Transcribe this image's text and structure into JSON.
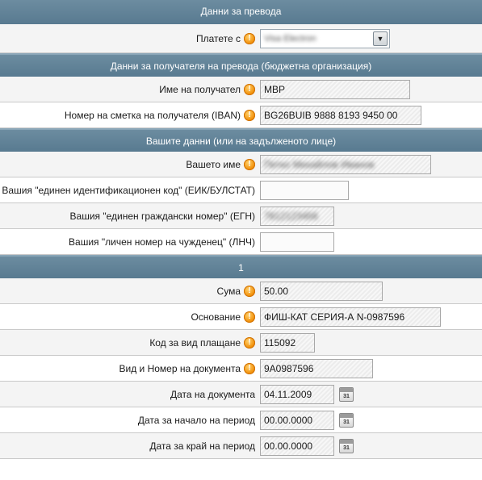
{
  "sections": {
    "transfer": "Данни за превода",
    "recipient": "Данни за получателя на превода (бюджетна организация)",
    "payer": "Вашите данни (или на задълженото лице)",
    "document": "1"
  },
  "fields": {
    "pay_with": {
      "label": "Платете с",
      "value": "Visa Electron"
    },
    "recipient_name": {
      "label": "Име на получател",
      "value": "МВР"
    },
    "recipient_iban": {
      "label": "Номер на сметка на получателя (IBAN)",
      "value": "BG26BUIB 9888 8193 9450 00"
    },
    "your_name": {
      "label": "Вашето име",
      "value": "Петко Михайлов Иванов"
    },
    "eik": {
      "label": "Вашия \"единен идентификационен код\" (ЕИК/БУЛСТАТ)",
      "value": ""
    },
    "egn": {
      "label": "Вашия \"единен граждански номер\" (ЕГН)",
      "value": "7812123456"
    },
    "lnch": {
      "label": "Вашия \"личен номер на чужденец\" (ЛНЧ)",
      "value": ""
    },
    "amount": {
      "label": "Сума",
      "value": "50.00"
    },
    "reason": {
      "label": "Основание",
      "value": "ФИШ-КАТ СЕРИЯ-А N-0987596"
    },
    "payment_code": {
      "label": "Код за вид плащане",
      "value": "115092"
    },
    "doc_type_number": {
      "label": "Вид и Номер на документа",
      "value": "9A0987596"
    },
    "doc_date": {
      "label": "Дата на документа",
      "value": "04.11.2009"
    },
    "period_start": {
      "label": "Дата за начало на период",
      "value": "00.00.0000"
    },
    "period_end": {
      "label": "Дата за край на период",
      "value": "00.00.0000"
    }
  },
  "icons": {
    "warning": "!",
    "calendar": "31",
    "dropdown": "▼"
  },
  "colors": {
    "header": "#6c8ca0",
    "warning": "#f08a00"
  }
}
